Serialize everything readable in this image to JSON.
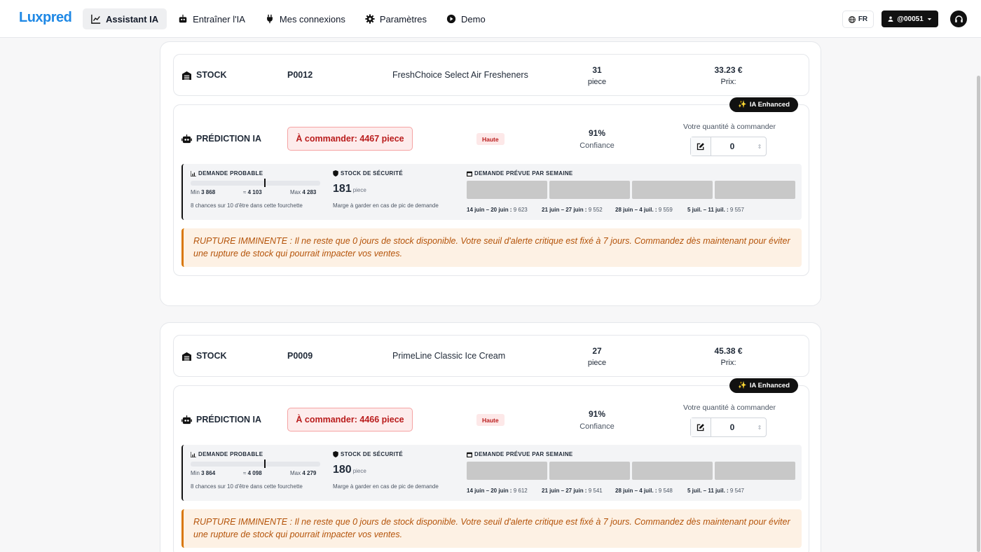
{
  "app": {
    "logo": "Luxpred"
  },
  "nav": [
    {
      "label": "Assistant IA",
      "icon": "chart-line-icon",
      "active": true
    },
    {
      "label": "Entraîner l'IA",
      "icon": "robot-icon",
      "active": false
    },
    {
      "label": "Mes connexions",
      "icon": "plug-icon",
      "active": false
    },
    {
      "label": "Paramètres",
      "icon": "gear-icon",
      "active": false
    },
    {
      "label": "Demo",
      "icon": "play-icon",
      "active": false
    }
  ],
  "header": {
    "lang": "FR",
    "user": "@00051"
  },
  "products": [
    {
      "stock_label": "STOCK",
      "code": "P0012",
      "name": "FreshChoice Select Air Fresheners",
      "qty": "31",
      "qty_unit": "piece",
      "price": "33.23 €",
      "price_label": "Prix:",
      "badge": "IA Enhanced",
      "pred_label": "PRÉDICTION IA",
      "order": "À commander: 4467 piece",
      "priority": "Haute",
      "confidence": "91%",
      "confidence_label": "Confiance",
      "qty_input_label": "Votre quantité à commander",
      "qty_input_value": "0",
      "demand_title": "DEMANDE PROBABLE",
      "demand_min_label": "Min",
      "demand_min": "3 868",
      "demand_mid_label": "≈",
      "demand_mid": "4 103",
      "demand_max_label": "Max",
      "demand_max": "4 283",
      "demand_marker": 0.57,
      "demand_note": "8 chances sur 10 d'être dans cette fourchette",
      "safety_title": "STOCK DE SÉCURITÉ",
      "safety_value": "181",
      "safety_unit": "piece",
      "safety_note": "Marge à garder en cas de pic de demande",
      "weekly_title": "DEMANDE PRÉVUE PAR SEMAINE",
      "weeks": [
        {
          "range": "14 juin – 20 juin :",
          "value": "9 623"
        },
        {
          "range": "21 juin – 27 juin :",
          "value": "9 552"
        },
        {
          "range": "28 juin – 4 juil. :",
          "value": "9 559"
        },
        {
          "range": "5 juil. – 11 juil. :",
          "value": "9 557"
        }
      ],
      "alert": "RUPTURE IMMINENTE : Il ne reste que 0 jours de stock disponible. Votre seuil d'alerte critique est fixé à 7 jours. Commandez dès maintenant pour éviter une rupture de stock qui pourrait impacter vos ventes."
    },
    {
      "stock_label": "STOCK",
      "code": "P0009",
      "name": "PrimeLine Classic Ice Cream",
      "qty": "27",
      "qty_unit": "piece",
      "price": "45.38 €",
      "price_label": "Prix:",
      "badge": "IA Enhanced",
      "pred_label": "PRÉDICTION IA",
      "order": "À commander: 4466 piece",
      "priority": "Haute",
      "confidence": "91%",
      "confidence_label": "Confiance",
      "qty_input_label": "Votre quantité à commander",
      "qty_input_value": "0",
      "demand_title": "DEMANDE PROBABLE",
      "demand_min_label": "Min",
      "demand_min": "3 864",
      "demand_mid_label": "≈",
      "demand_mid": "4 098",
      "demand_max_label": "Max",
      "demand_max": "4 279",
      "demand_marker": 0.57,
      "demand_note": "8 chances sur 10 d'être dans cette fourchette",
      "safety_title": "STOCK DE SÉCURITÉ",
      "safety_value": "180",
      "safety_unit": "piece",
      "safety_note": "Marge à garder en cas de pic de demande",
      "weekly_title": "DEMANDE PRÉVUE PAR SEMAINE",
      "weeks": [
        {
          "range": "14 juin – 20 juin :",
          "value": "9 612"
        },
        {
          "range": "21 juin – 27 juin :",
          "value": "9 541"
        },
        {
          "range": "28 juin – 4 juil. :",
          "value": "9 548"
        },
        {
          "range": "5 juil. – 11 juil. :",
          "value": "9 547"
        }
      ],
      "alert": "RUPTURE IMMINENTE : Il ne reste que 0 jours de stock disponible. Votre seuil d'alerte critique est fixé à 7 jours. Commandez dès maintenant pour éviter une rupture de stock qui pourrait impacter vos ventes."
    }
  ]
}
